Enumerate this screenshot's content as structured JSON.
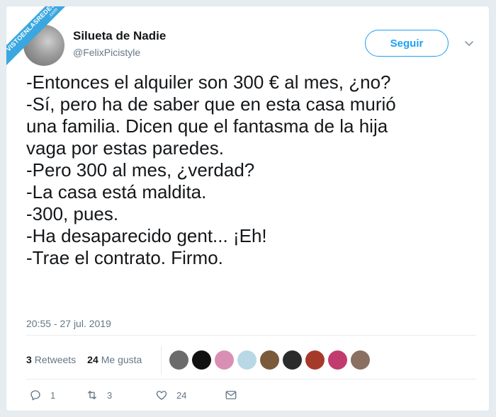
{
  "watermark": {
    "line1": "VISTOENLASREDES",
    "line2": ".com"
  },
  "author": {
    "name": "Silueta de Nadie",
    "handle": "@FelixPicistyle"
  },
  "follow_button": {
    "label": "Seguir"
  },
  "tweet": {
    "lines": [
      "-Entonces el alquiler son 300 € al mes, ¿no?",
      "-Sí, pero ha de saber que en esta casa murió",
      "una familia. Dicen que el fantasma de la hija",
      "vaga por estas paredes.",
      "-Pero 300 al mes, ¿verdad?",
      "-La casa está maldita.",
      "-300, pues.",
      "-Ha desaparecido gent... ¡Eh!",
      "-Trae el contrato. Firmo."
    ],
    "timestamp": "20:55 - 27 jul. 2019"
  },
  "stats": {
    "retweets_count": "3",
    "retweets_label": "Retweets",
    "likes_count": "24",
    "likes_label": "Me gusta"
  },
  "likers": [
    "#6b6b6b",
    "#111111",
    "#d98fb3",
    "#b9d8e6",
    "#7a5a3a",
    "#2b2b2b",
    "#a63a2a",
    "#c23b6e",
    "#8a7060"
  ],
  "actions": {
    "replies": "1",
    "retweets": "3",
    "likes": "24"
  },
  "colors": {
    "accent": "#1da1f2",
    "muted": "#657786",
    "watermark": "#3aa7e0"
  }
}
